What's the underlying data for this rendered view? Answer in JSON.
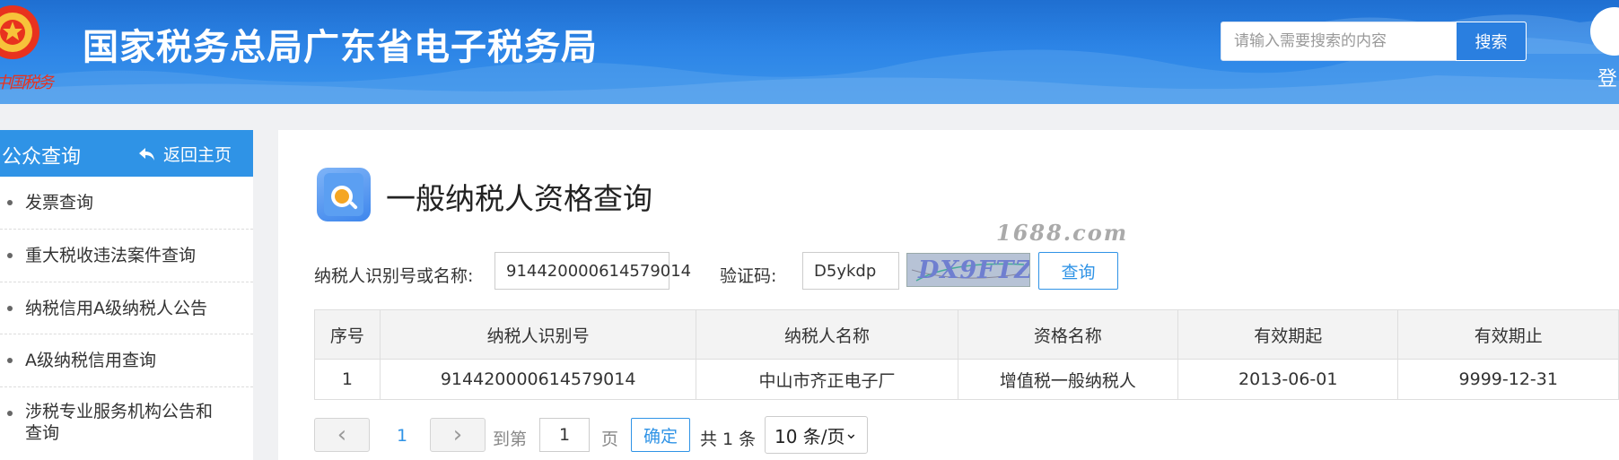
{
  "header": {
    "site_title": "国家税务总局广东省电子税务局",
    "seal_text": "中国税务",
    "search_placeholder": "请输入需要搜索的内容",
    "search_button": "搜索",
    "login_label": "登"
  },
  "sidebar": {
    "title": "公众查询",
    "back_home": "返回主页",
    "items": [
      {
        "label": "发票查询"
      },
      {
        "label": "重大税收违法案件查询"
      },
      {
        "label": "纳税信用A级纳税人公告"
      },
      {
        "label": "A级纳税信用查询"
      },
      {
        "label": "涉税专业服务机构公告和查询"
      }
    ]
  },
  "main": {
    "page_title": "一般纳税人资格查询",
    "watermark": "1688.com",
    "form": {
      "taxpayer_label": "纳税人识别号或名称:",
      "taxpayer_value": "914420000614579014",
      "captcha_label": "验证码:",
      "captcha_value": "D5ykdp",
      "captcha_image_text": "DX9FTZ",
      "query_button": "查询"
    },
    "table": {
      "headers": [
        "序号",
        "纳税人识别号",
        "纳税人名称",
        "资格名称",
        "有效期起",
        "有效期止"
      ],
      "rows": [
        [
          "1",
          "914420000614579014",
          "中山市齐正电子厂",
          "增值税一般纳税人",
          "2013-06-01",
          "9999-12-31"
        ]
      ]
    },
    "pagination": {
      "prev": "‹",
      "current_page": "1",
      "next": "›",
      "goto_label": "到第",
      "goto_value": "1",
      "page_unit": "页",
      "confirm": "确定",
      "total": "共 1 条",
      "page_size": "10 条/页"
    }
  },
  "colors": {
    "header_blue": "#2c84e6",
    "accent": "#2f93e6"
  }
}
